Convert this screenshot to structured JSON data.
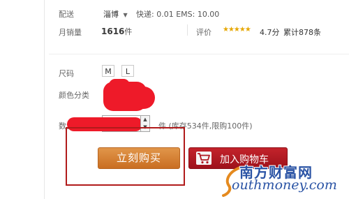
{
  "shipping": {
    "label": "配送",
    "location": "淄博",
    "dropdown_icon": "caret-down",
    "fee_text": "快递: 0.01 EMS: 10.00"
  },
  "sales": {
    "label": "月销量",
    "count": "1616",
    "unit": "件"
  },
  "rating": {
    "label": "评价",
    "stars": "★★★★★",
    "score": "4.7分",
    "total": "累计878条"
  },
  "size": {
    "label": "尺码",
    "options": [
      "M",
      "L"
    ]
  },
  "color": {
    "label": "颜色分类"
  },
  "quantity": {
    "label": "数量",
    "value": "1",
    "stock_text": "件 (库存534件,限购100件)"
  },
  "actions": {
    "buy_now": "立刻购买",
    "add_to_cart": "加入购物车"
  },
  "watermark": {
    "cn": "南方财富网",
    "en": "outhmoney.com"
  },
  "colors": {
    "buy_button": "#d4803a",
    "cart_button": "#b01a22",
    "highlight_box": "#b11b1b",
    "redaction": "#ee1a29",
    "star": "#e6a700",
    "watermark": "#2b54a5"
  }
}
